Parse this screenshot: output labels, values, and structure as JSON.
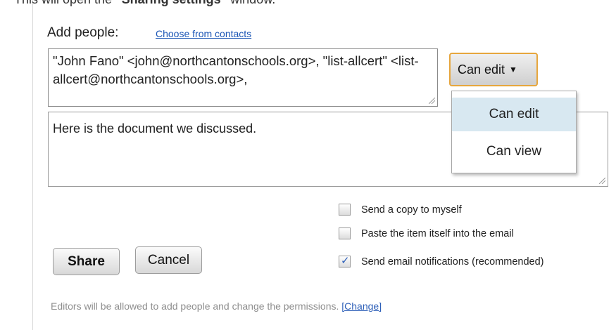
{
  "caption": {
    "text_before": "This will open the ",
    "text_bold": "\"Sharing settings\"",
    "text_after": " window."
  },
  "share_form": {
    "add_people_label": "Add people:",
    "choose_contacts_link": "Choose from contacts",
    "recipients_value": "\"John Fano\" <john@northcantonschools.org>, \"list-allcert\" <list-allcert@northcantonschools.org>,",
    "message_value": "Here is the document we discussed."
  },
  "permission": {
    "selected": "Can edit",
    "options": [
      "Can edit",
      "Can view"
    ]
  },
  "options": {
    "send_copy": {
      "label": "Send a copy to myself",
      "checked": false
    },
    "paste_item": {
      "label": "Paste the item itself into the email",
      "checked": false
    },
    "send_notifications": {
      "label": "Send email notifications (recommended)",
      "checked": true
    }
  },
  "actions": {
    "share_label": "Share",
    "cancel_label": "Cancel"
  },
  "footer": {
    "note": "Editors will be allowed to add people and change the permissions. ",
    "change_link": "[Change]"
  },
  "colors": {
    "link": "#1a55b5",
    "focus_border": "#e6a63d",
    "menu_highlight": "#d8e8f1"
  }
}
